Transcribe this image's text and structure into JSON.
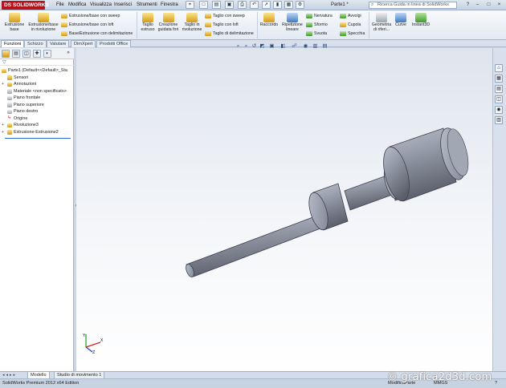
{
  "app": {
    "logo_text": "SOLIDWORKS",
    "document_title": "Parte1 *",
    "search_placeholder": "Ricerca Guida in linea di SolidWorks",
    "menu": [
      "File",
      "Modifica",
      "Visualizza",
      "Inserisci",
      "Strumenti",
      "Finestra"
    ],
    "window_buttons": [
      "?",
      "–",
      "□",
      "×"
    ]
  },
  "ribbon": {
    "big_buttons": [
      {
        "label1": "Estrusione",
        "label2": "base"
      },
      {
        "label1": "Estrusione/base",
        "label2": "in rivoluzione"
      },
      {
        "label1": "Taglio",
        "label2": "estruso"
      },
      {
        "label1": "Creazione",
        "label2": "guidata fori"
      },
      {
        "label1": "Taglio in",
        "label2": "rivoluzione"
      },
      {
        "label1": "Raccordo",
        "label2": ""
      },
      {
        "label1": "Ripetizione",
        "label2": "lineare"
      },
      {
        "label1": "Geometria",
        "label2": "di riferi..."
      },
      {
        "label1": "Curve",
        "label2": ""
      },
      {
        "label1": "Instant3D",
        "label2": ""
      }
    ],
    "small_col1": [
      "Estrusione/base con sweep",
      "Estrusione/base con loft",
      "Base/Estrusione con delimitazione"
    ],
    "small_col2": [
      "Taglio con sweep",
      "Taglio con loft",
      "Taglio di delimitazione"
    ],
    "small_col3": [
      "Nervatura",
      "Sformo",
      "Svuota"
    ],
    "small_col4": [
      "Avvolgi",
      "Cupola",
      "Specchia"
    ]
  },
  "tabs": [
    "Funzioni",
    "Schizzo",
    "Valutare",
    "DimXpert",
    "Prodotti Office"
  ],
  "feature_tree": {
    "root": "Parte1  (Default<<Default>_Sta",
    "items": [
      {
        "label": "Sensori",
        "expand": ""
      },
      {
        "label": "Annotazioni",
        "expand": "+"
      },
      {
        "label": "Materiale <non specificato>",
        "expand": ""
      },
      {
        "label": "Piano frontale",
        "expand": ""
      },
      {
        "label": "Piano superiore",
        "expand": ""
      },
      {
        "label": "Piano destro",
        "expand": ""
      },
      {
        "label": "Origine",
        "expand": ""
      },
      {
        "label": "Rivoluzione3",
        "expand": "+"
      },
      {
        "label": "Estrusione-Estrusione2",
        "expand": "+"
      }
    ]
  },
  "bottom_tabs": [
    "Modello",
    "Studio di movimento 1"
  ],
  "status": {
    "left": "SolidWorks Premium 2012 x64 Edition",
    "mode": "ModificaParte",
    "units": "MMGS",
    "help": "?"
  },
  "watermark": "© grafica2d3d.com",
  "colors": {
    "accent": "#b5121b",
    "model_fill": "#8f95a3",
    "background_top": "#dfe5ed"
  }
}
